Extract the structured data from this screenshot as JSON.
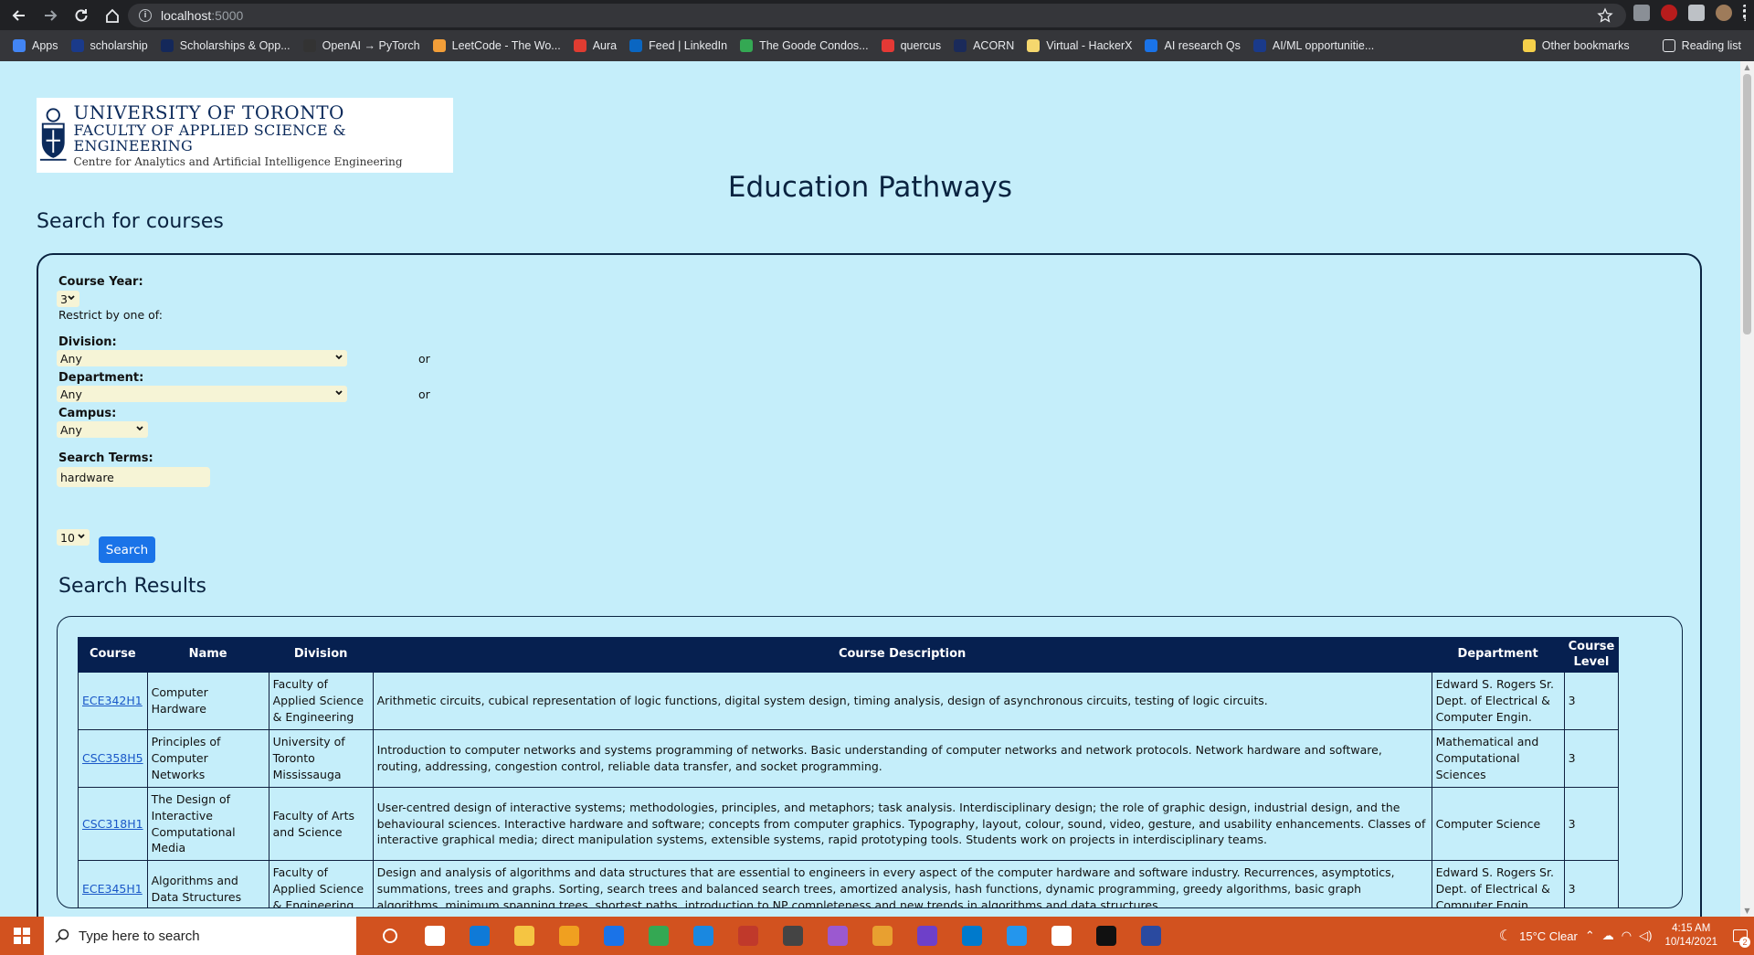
{
  "browser": {
    "url_host": "localhost",
    "url_port": ":5000",
    "bookmarks": [
      "Apps",
      "scholarship",
      "Scholarships & Opp...",
      "OpenAI → PyTorch",
      "LeetCode - The Wo...",
      "Aura",
      "Feed | LinkedIn",
      "The Goode Condos...",
      "quercus",
      "ACORN",
      "Virtual - HackerX",
      "AI research Qs",
      "AI/ML opportunitie..."
    ],
    "bookmark_colors": [
      "#4285f4",
      "#1a3a8a",
      "#14285a",
      "#333333",
      "#f29e38",
      "#e03c31",
      "#0a66c2",
      "#34a853",
      "#e53935",
      "#1a2a5a",
      "#f5d76e",
      "#1a73e8",
      "#1a3a8a"
    ],
    "other_bookmarks": "Other bookmarks",
    "reading_list": "Reading list"
  },
  "logo": {
    "line1": "UNIVERSITY OF TORONTO",
    "line2": "FACULTY OF APPLIED SCIENCE & ENGINEERING",
    "line3": "Centre for Analytics and Artificial Intelligence Engineering"
  },
  "page": {
    "title": "Education Pathways",
    "search_heading": "Search for courses"
  },
  "form": {
    "course_year_label": "Course Year:",
    "course_year_value": "3",
    "restrict_text": "Restrict by one of:",
    "division_label": "Division:",
    "division_value": "Any",
    "department_label": "Department:",
    "department_value": "Any",
    "campus_label": "Campus:",
    "campus_value": "Any",
    "or_text": "or",
    "search_terms_label": "Search Terms:",
    "search_terms_value": "hardware",
    "results_count_value": "10",
    "search_button": "Search"
  },
  "results": {
    "heading": "Search Results",
    "columns": [
      "Course",
      "Name",
      "Division",
      "Course Description",
      "Department",
      "Course Level"
    ],
    "rows": [
      {
        "course": "ECE342H1",
        "name": "Computer Hardware",
        "division": "Faculty of Applied Science & Engineering",
        "description": "Arithmetic circuits, cubical representation of logic functions, digital system design, timing analysis, design of asynchronous circuits, testing of logic circuits.",
        "department": "Edward S. Rogers Sr. Dept. of Electrical & Computer Engin.",
        "level": "3"
      },
      {
        "course": "CSC358H5",
        "name": "Principles of Computer Networks",
        "division": "University of Toronto Mississauga",
        "description": "Introduction to computer networks and systems programming of networks. Basic understanding of computer networks and network protocols. Network hardware and software, routing, addressing, congestion control, reliable data transfer, and socket programming.",
        "department": "Mathematical and Computational Sciences",
        "level": "3"
      },
      {
        "course": "CSC318H1",
        "name": "The Design of Interactive Computational Media",
        "division": "Faculty of Arts and Science",
        "description": "User-centred design of interactive systems; methodologies, principles, and metaphors; task analysis. Interdisciplinary design; the role of graphic design, industrial design, and the behavioural sciences. Interactive hardware and software; concepts from computer graphics. Typography, layout, colour, sound, video, gesture, and usability enhancements. Classes of interactive graphical media; direct manipulation systems, extensible systems, rapid prototyping tools. Students work on projects in interdisciplinary teams.",
        "department": "Computer Science",
        "level": "3"
      },
      {
        "course": "ECE345H1",
        "name": "Algorithms and Data Structures",
        "division": "Faculty of Applied Science & Engineering",
        "description": "Design and analysis of algorithms and data structures that are essential to engineers in every aspect of the computer hardware and software industry. Recurrences, asymptotics, summations, trees and graphs. Sorting, search trees and balanced search trees, amortized analysis, hash functions, dynamic programming, greedy algorithms, basic graph algorithms, minimum spanning trees, shortest paths, introduction to NP completeness and new trends in algorithms and data structures.",
        "department": "Edward S. Rogers Sr. Dept. of Electrical & Computer Engin.",
        "level": "3"
      }
    ]
  },
  "taskbar": {
    "search_placeholder": "Type here to search",
    "weather": "15°C  Clear",
    "time": "4:15 AM",
    "date": "10/14/2021",
    "notification_count": "2",
    "app_colors": [
      "#ffffff",
      "#ffffff",
      "#0f7ad7",
      "#f5c542",
      "#f0a020",
      "#1a73e8",
      "#34a853",
      "#1a88e0",
      "#c0392b",
      "#444444",
      "#9b59d0",
      "#e8a030",
      "#6e40c9",
      "#007acc",
      "#2496ed",
      "#ffffff",
      "#111111",
      "#2a4aa0"
    ]
  },
  "colors": {
    "page_bg": "#c5eefa",
    "table_header": "#062050",
    "button": "#1a73e8",
    "taskbar": "#d2521f"
  }
}
